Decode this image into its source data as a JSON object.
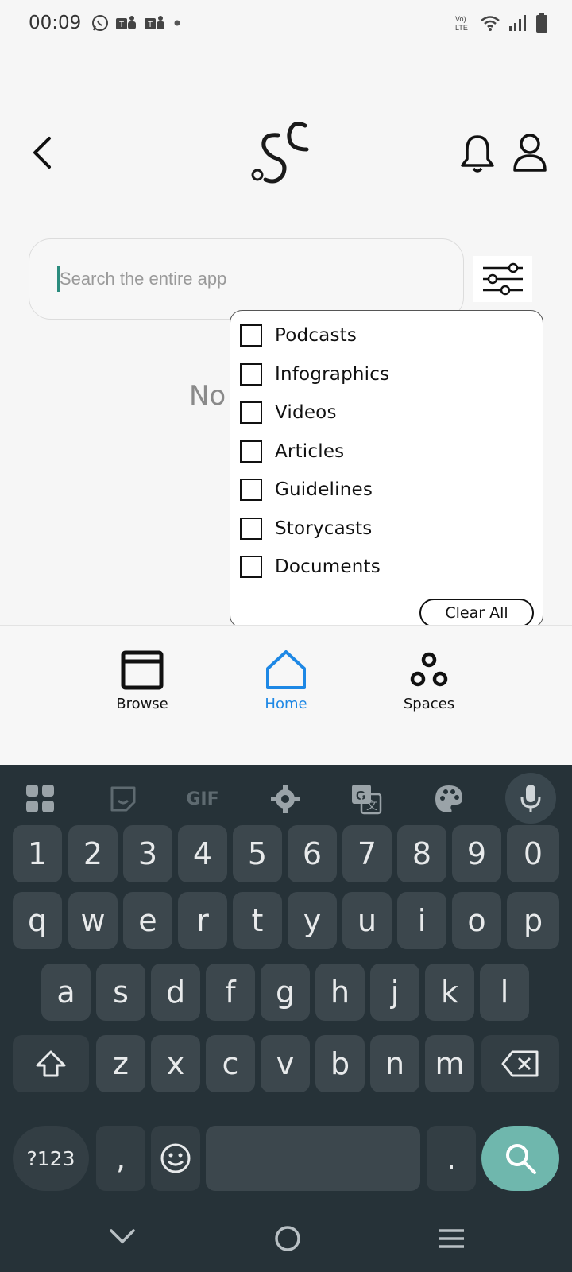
{
  "status_bar": {
    "time": "00:09",
    "network_label": "Vo) LTE"
  },
  "header": {
    "logo_alt": "SC"
  },
  "search": {
    "placeholder": "Search the entire app",
    "value": ""
  },
  "results": {
    "empty_text": "No"
  },
  "filter": {
    "options": [
      {
        "label": "Podcasts",
        "checked": false
      },
      {
        "label": "Infographics",
        "checked": false
      },
      {
        "label": "Videos",
        "checked": false
      },
      {
        "label": "Articles",
        "checked": false
      },
      {
        "label": "Guidelines",
        "checked": false
      },
      {
        "label": "Storycasts",
        "checked": false
      },
      {
        "label": "Documents",
        "checked": false
      }
    ],
    "clear_label": "Clear All"
  },
  "bottom_nav": {
    "items": [
      {
        "label": "Browse",
        "active": false
      },
      {
        "label": "Home",
        "active": true
      },
      {
        "label": "Spaces",
        "active": false
      }
    ],
    "active_color": "#1e88e5"
  },
  "keyboard": {
    "toolbar_gif": "GIF",
    "rows": {
      "numbers": [
        "1",
        "2",
        "3",
        "4",
        "5",
        "6",
        "7",
        "8",
        "9",
        "0"
      ],
      "row1": [
        "q",
        "w",
        "e",
        "r",
        "t",
        "y",
        "u",
        "i",
        "o",
        "p"
      ],
      "row2": [
        "a",
        "s",
        "d",
        "f",
        "g",
        "h",
        "j",
        "k",
        "l"
      ],
      "row3": [
        "z",
        "x",
        "c",
        "v",
        "b",
        "n",
        "m"
      ]
    },
    "symbols_label": "?123",
    "comma": ",",
    "period": ".",
    "accent_color": "#6fb7ad"
  }
}
